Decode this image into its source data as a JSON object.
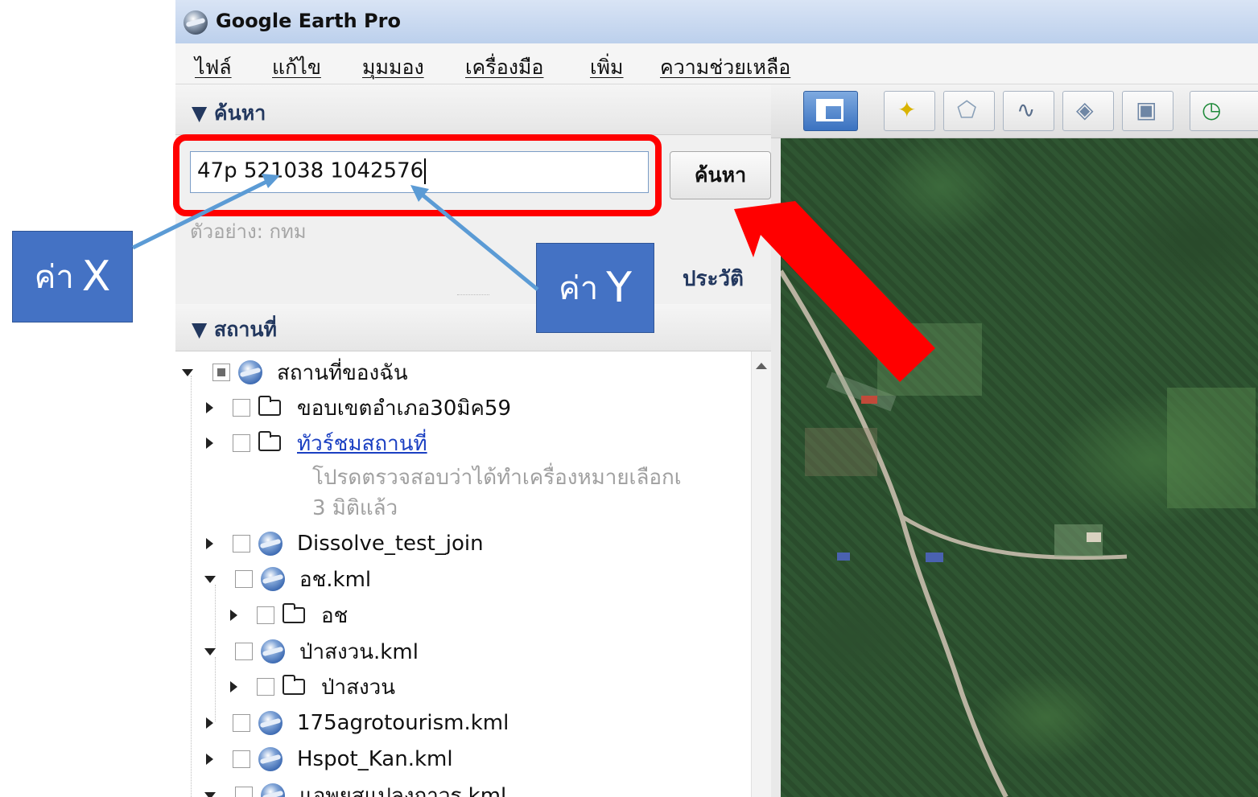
{
  "window": {
    "title": "Google Earth Pro"
  },
  "menu": [
    "ไฟล์",
    "แก้ไข",
    "มุมมอง",
    "เครื่องมือ",
    "เพิ่ม",
    "ความช่วยเหลือ"
  ],
  "search": {
    "section_label": "▼ ค้นหา",
    "input_value": "47p 521038 1042576",
    "button_label": "ค้นหา",
    "hint": "ตัวอย่าง: กทม",
    "history_label": "ประวัติ"
  },
  "places": {
    "section_label": "▼ สถานที่",
    "items": [
      {
        "label": "สถานที่ของฉัน"
      },
      {
        "label": "ขอบเขตอำเภอ30มิค59"
      },
      {
        "label": "ทัวร์ชมสถานที่"
      },
      {
        "label": "โปรดตรวจสอบว่าได้ทำเครื่องหมายเลือกเ"
      },
      {
        "label": "3 มิติแล้ว"
      },
      {
        "label": "Dissolve_test_join"
      },
      {
        "label": "อช.kml"
      },
      {
        "label": "อช"
      },
      {
        "label": "ป่าสงวน.kml"
      },
      {
        "label": "ป่าสงวน"
      },
      {
        "label": "175agrotourism.kml"
      },
      {
        "label": "Hspot_Kan.kml"
      },
      {
        "label": "แอพยสแปลงถาวร.kml"
      }
    ]
  },
  "toolbar": {
    "icons": [
      "sidebar-toggle-icon",
      "add-placemark-icon",
      "add-polygon-icon",
      "add-path-icon",
      "add-image-overlay-icon",
      "record-tour-icon",
      "historical-imagery-icon"
    ]
  },
  "annotations": {
    "x_label": {
      "prefix": "ค่า",
      "letter": "X"
    },
    "y_label": {
      "prefix": "ค่า",
      "letter": "Y"
    },
    "highlight_color": "#ff0000",
    "label_color": "#4472c4",
    "pointer_color": "#5b9bd5"
  }
}
